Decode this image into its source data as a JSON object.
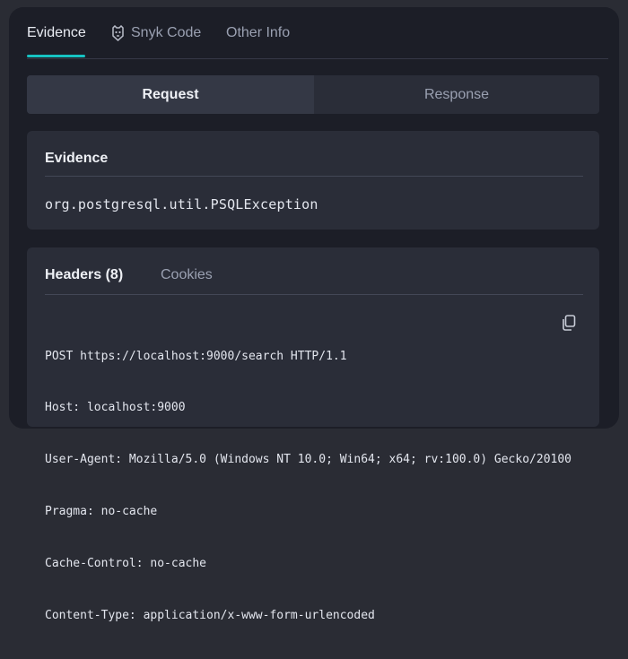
{
  "tabs": [
    {
      "label": "Evidence",
      "icon": null
    },
    {
      "label": "Snyk Code",
      "icon": "snyk-dog-icon"
    },
    {
      "label": "Other Info",
      "icon": null
    }
  ],
  "segment": {
    "request": "Request",
    "response": "Response"
  },
  "evidence": {
    "title": "Evidence",
    "value": "org.postgresql.util.PSQLException"
  },
  "request_panel": {
    "headers_tab": "Headers (8)",
    "cookies_tab": "Cookies",
    "lines": [
      "POST https://localhost:9000/search HTTP/1.1",
      "Host: localhost:9000",
      "User-Agent: Mozilla/5.0 (Windows NT 10.0; Win64; x64; rv:100.0) Gecko/20100",
      "Pragma: no-cache",
      "Cache-Control: no-cache",
      "Content-Type: application/x-www-form-urlencoded"
    ]
  },
  "colors": {
    "accent": "#16c2c2",
    "panel": "#1c1e27",
    "card": "#2a2d38"
  }
}
